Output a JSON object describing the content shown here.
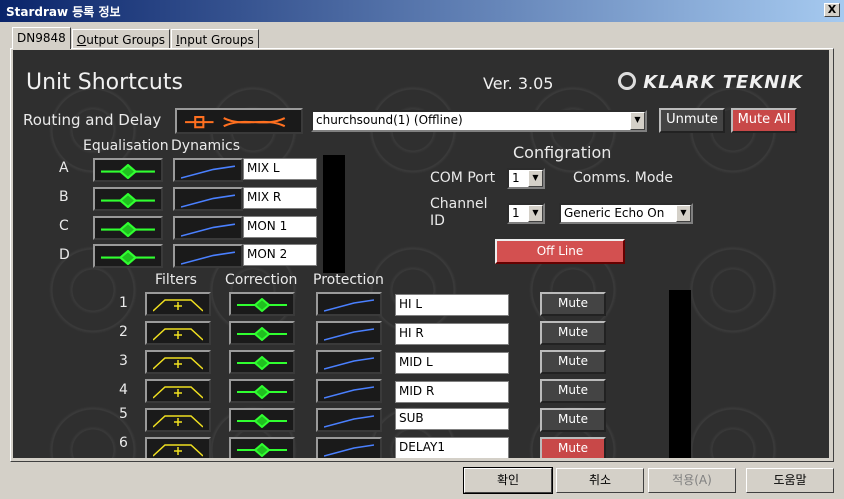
{
  "window": {
    "title": "Stardraw 등록 정보",
    "close_label": "X"
  },
  "tabs": [
    {
      "label": "DN9848",
      "active": true
    },
    {
      "label": "Output Groups",
      "underline": "O",
      "rest": "utput Groups"
    },
    {
      "label": "Input Groups",
      "underline": "I",
      "rest": "nput Groups"
    }
  ],
  "header": {
    "title": "Unit Shortcuts",
    "version": "Ver. 3.05",
    "brand": "KLARK TEKNIK"
  },
  "routing": {
    "label": "Routing and Delay",
    "device": "churchsound(1) (Offline)",
    "unmute": "Unmute",
    "mute_all": "Mute All"
  },
  "inputs": {
    "col_eq": "Equalisation",
    "col_dyn": "Dynamics",
    "rows": [
      {
        "letter": "A",
        "name": "MIX L"
      },
      {
        "letter": "B",
        "name": "MIX R"
      },
      {
        "letter": "C",
        "name": "MON 1"
      },
      {
        "letter": "D",
        "name": "MON 2"
      }
    ]
  },
  "config": {
    "title": "Configration",
    "com_port_label": "COM Port",
    "com_port": "1",
    "comms_mode_label": "Comms. Mode",
    "channel_label_1": "Channel",
    "channel_label_2": "ID",
    "channel_id": "1",
    "comms_mode": "Generic Echo On",
    "status": "Off Line"
  },
  "outputs": {
    "col_filters": "Filters",
    "col_correction": "Correction",
    "col_protection": "Protection",
    "rows": [
      {
        "num": "1",
        "name": "HI L",
        "mute": "Mute",
        "muted": false
      },
      {
        "num": "2",
        "name": "HI R",
        "mute": "Mute",
        "muted": false
      },
      {
        "num": "3",
        "name": "MID L",
        "mute": "Mute",
        "muted": false
      },
      {
        "num": "4",
        "name": "MID R",
        "mute": "Mute",
        "muted": false
      },
      {
        "num": "5",
        "name": "SUB",
        "mute": "Mute",
        "muted": false
      },
      {
        "num": "6",
        "name": "DELAY1",
        "mute": "Mute",
        "muted": true
      }
    ]
  },
  "footer": {
    "ok": "확인",
    "cancel": "취소",
    "apply": "적용(A)",
    "help": "도움말"
  }
}
